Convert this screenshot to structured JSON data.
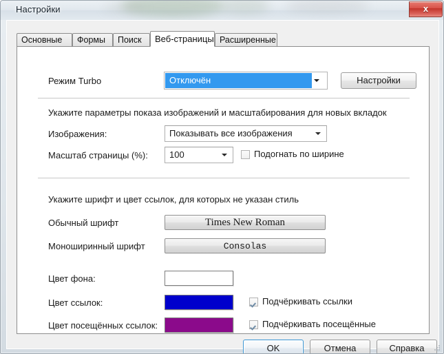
{
  "window": {
    "title": "Настройки",
    "close_label": "x"
  },
  "tabs": [
    {
      "label": "Основные",
      "active": false
    },
    {
      "label": "Формы",
      "active": false
    },
    {
      "label": "Поиск",
      "active": false
    },
    {
      "label": "Веб-страницы",
      "active": true
    },
    {
      "label": "Расширенные",
      "active": false
    }
  ],
  "page": {
    "turbo": {
      "label": "Режим Turbo",
      "value": "Отключён",
      "settings_button": "Настройки"
    },
    "images_section": {
      "heading": "Укажите параметры показа изображений и масштабирования для новых вкладок",
      "images_label": "Изображения:",
      "images_value": "Показывать все изображения",
      "zoom_label": "Масштаб страницы (%):",
      "zoom_value": "100",
      "fit_width_label": "Подогнать по ширине",
      "fit_width_checked": false
    },
    "fonts_section": {
      "heading": "Укажите шрифт и цвет ссылок, для которых не указан стиль",
      "normal_font_label": "Обычный шрифт",
      "normal_font_value": "Times New Roman",
      "mono_font_label": "Моноширинный шрифт",
      "mono_font_value": "Consolas"
    },
    "colors_section": {
      "background_label": "Цвет фона:",
      "background_color": "#ffffff",
      "link_label": "Цвет ссылок:",
      "link_color": "#0000cc",
      "visited_label": "Цвет посещённых ссылок:",
      "visited_color": "#8b0a8b",
      "underline_links_label": "Подчёркивать ссылки",
      "underline_links_checked": true,
      "underline_visited_label": "Подчёркивать посещённые",
      "underline_visited_checked": true
    }
  },
  "buttons": {
    "ok": "OK",
    "cancel": "Отмена",
    "help": "Справка"
  }
}
